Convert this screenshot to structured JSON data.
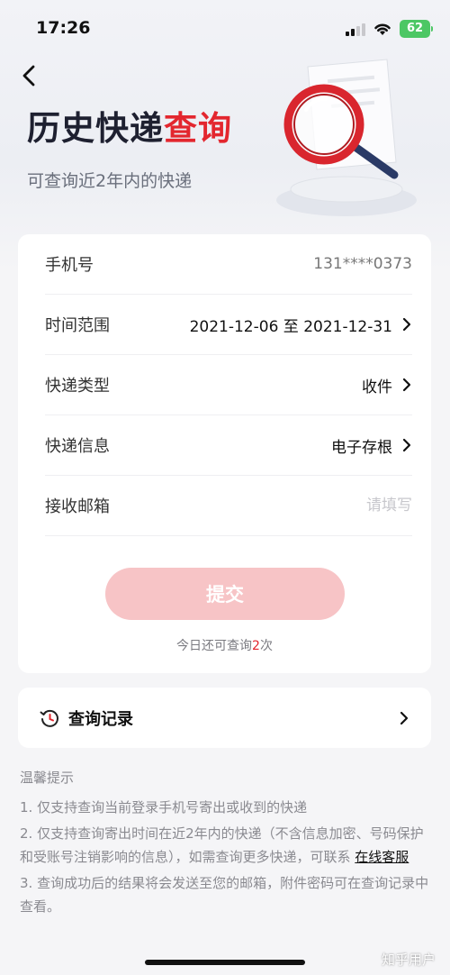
{
  "status_bar": {
    "time": "17:26",
    "battery": "62"
  },
  "header": {
    "title_main": "历史快递",
    "title_accent": "查询",
    "subtitle": "可查询近2年内的快递"
  },
  "form": {
    "phone": {
      "label": "手机号",
      "value": "131****0373"
    },
    "time_range": {
      "label": "时间范围",
      "value": "2021-12-06 至 2021-12-31"
    },
    "type": {
      "label": "快递类型",
      "value": "收件"
    },
    "info": {
      "label": "快递信息",
      "value": "电子存根"
    },
    "email": {
      "label": "接收邮箱",
      "placeholder": "请填写",
      "value": ""
    },
    "submit_label": "提交",
    "quota_prefix": "今日还可查询",
    "quota_count": "2",
    "quota_suffix": "次"
  },
  "history": {
    "label": "查询记录"
  },
  "tips": {
    "title": "温馨提示",
    "items": [
      "1. 仅支持查询当前登录手机号寄出或收到的快递",
      "2. 仅支持查询寄出时间在近2年内的快递（不含信息加密、号码保护和受账号注销影响的信息），如需查询更多快递，可联系",
      "3. 查询成功后的结果将会发送至您的邮箱，附件密码可在查询记录中查看。"
    ],
    "link_text": "在线客服"
  },
  "watermark": "知乎用户",
  "colors": {
    "accent": "#e3262e",
    "submit_disabled": "#f7c4c6",
    "battery": "#4cc764",
    "background": "#f5f5f7"
  },
  "icons": [
    "signal-icon",
    "wifi-icon",
    "back-icon",
    "magnifier-illustration",
    "chevron-right-icon",
    "history-clock-icon"
  ]
}
